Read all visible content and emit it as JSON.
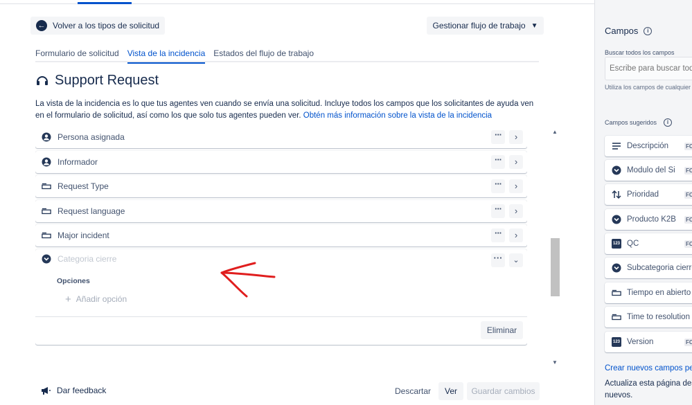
{
  "header": {
    "back_label": "Volver a los tipos de solicitud",
    "workflow_label": "Gestionar flujo de trabajo"
  },
  "tabs": [
    {
      "label": "Formulario de solicitud"
    },
    {
      "label": "Vista de la incidencia"
    },
    {
      "label": "Estados del flujo de trabajo"
    }
  ],
  "page": {
    "title": "Support Request",
    "description": "La vista de la incidencia es lo que tus agentes ven cuando se envía una solicitud. Incluye todos los campos que los solicitantes de ayuda ven en el formulario de solicitud, así como los que solo tus agentes pueden ver.",
    "learn_more": "Obtén más información sobre la vista de la incidencia"
  },
  "fields": [
    {
      "name": "Persona asignada",
      "icon": "user-icon"
    },
    {
      "name": "Informador",
      "icon": "user-icon"
    },
    {
      "name": "Request Type",
      "icon": "short-text-icon"
    },
    {
      "name": "Request language",
      "icon": "short-text-icon"
    },
    {
      "name": "Major incident",
      "icon": "short-text-icon"
    }
  ],
  "expanded_field": {
    "name": "Categoria cierre",
    "options_label": "Opciones",
    "add_option": "Añadir opción",
    "delete_label": "Eliminar"
  },
  "footer": {
    "feedback": "Dar feedback",
    "discard": "Descartar",
    "view": "Ver",
    "save": "Guardar cambios"
  },
  "panel": {
    "title": "Campos",
    "search_label": "Buscar todos los campos",
    "search_placeholder": "Escribe para buscar todos",
    "hint": "Utiliza los campos de cualquier",
    "suggested_label": "Campos sugeridos",
    "suggested": [
      {
        "name": "Descripción",
        "icon": "paragraph-icon",
        "tag": "FO"
      },
      {
        "name": "Modulo del Si",
        "icon": "select-icon",
        "tag": "FO"
      },
      {
        "name": "Prioridad",
        "icon": "priority-icon",
        "tag": "FO"
      },
      {
        "name": "Producto K2B",
        "icon": "select-icon",
        "tag": "FO"
      },
      {
        "name": "QC",
        "icon": "number-icon",
        "tag": "FO"
      },
      {
        "name": "Subcategoria cierre",
        "icon": "select-icon",
        "tag": ""
      },
      {
        "name": "Tiempo en abierto",
        "icon": "short-text-icon",
        "tag": ""
      },
      {
        "name": "Time to resolution",
        "icon": "short-text-icon",
        "tag": ""
      },
      {
        "name": "Version",
        "icon": "number-icon",
        "tag": "FO"
      }
    ],
    "create_link": "Crear nuevos campos per",
    "update_text": "Actualiza esta página des nuevos."
  },
  "colors": {
    "accent": "#0052cc",
    "text": "#172b4d",
    "annotation": "#e01e1e"
  }
}
